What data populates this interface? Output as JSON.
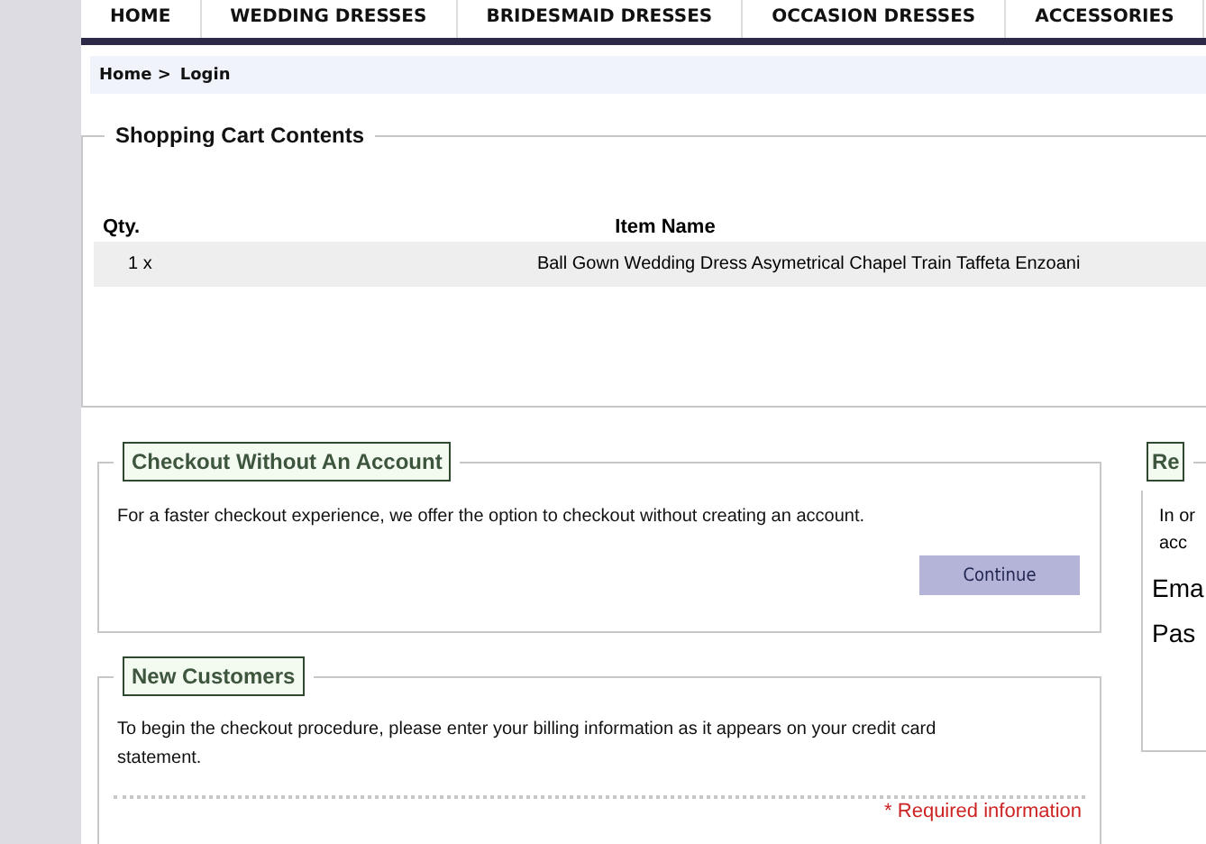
{
  "nav": [
    {
      "label": "HOME"
    },
    {
      "label": "WEDDING DRESSES"
    },
    {
      "label": "BRIDESMAID DRESSES"
    },
    {
      "label": "OCCASION DRESSES"
    },
    {
      "label": "ACCESSORIES"
    }
  ],
  "breadcrumb": [
    "Home >",
    "Login"
  ],
  "cart": {
    "title": "Shopping Cart Contents",
    "columns": [
      "Qty.",
      "Item Name"
    ],
    "rows": [
      {
        "qty": "1 x",
        "name": "Ball Gown Wedding Dress Asymetrical Chapel Train Taffeta Enzoani"
      }
    ]
  },
  "guest": {
    "title": "Checkout Without An Account",
    "text": "For a faster checkout experience, we offer the option to checkout without creating an account.",
    "button": "Continue"
  },
  "new_customers": {
    "title": "New Customers",
    "text": "To begin the checkout procedure, please enter your billing information as it appears on your credit card statement.",
    "required": "* Required information"
  },
  "returning": {
    "title": "Re",
    "text_lines": [
      "In or",
      "acc"
    ],
    "labels": [
      "Ema",
      "Pas"
    ]
  }
}
